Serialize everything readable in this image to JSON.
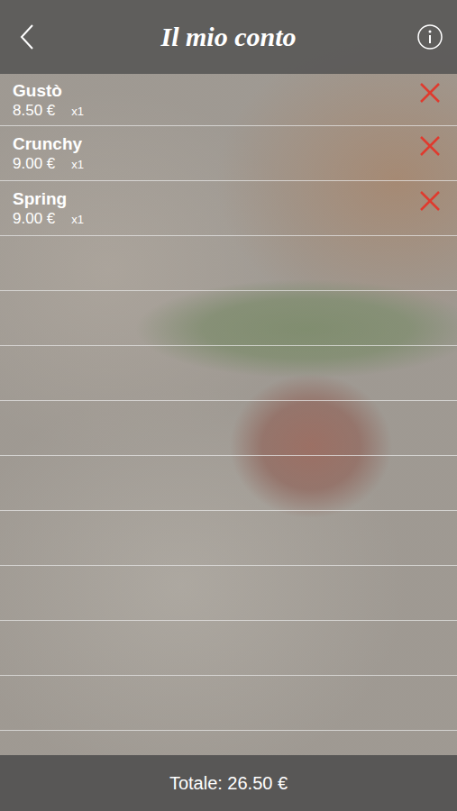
{
  "header": {
    "title": "Il mio conto"
  },
  "items": [
    {
      "name": "Gustò",
      "price": "8.50 €",
      "quantity": "x1"
    },
    {
      "name": "Crunchy",
      "price": "9.00 €",
      "quantity": "x1"
    },
    {
      "name": "Spring",
      "price": "9.00 €",
      "quantity": "x1"
    }
  ],
  "footer": {
    "total": "Totale: 26.50 €"
  }
}
